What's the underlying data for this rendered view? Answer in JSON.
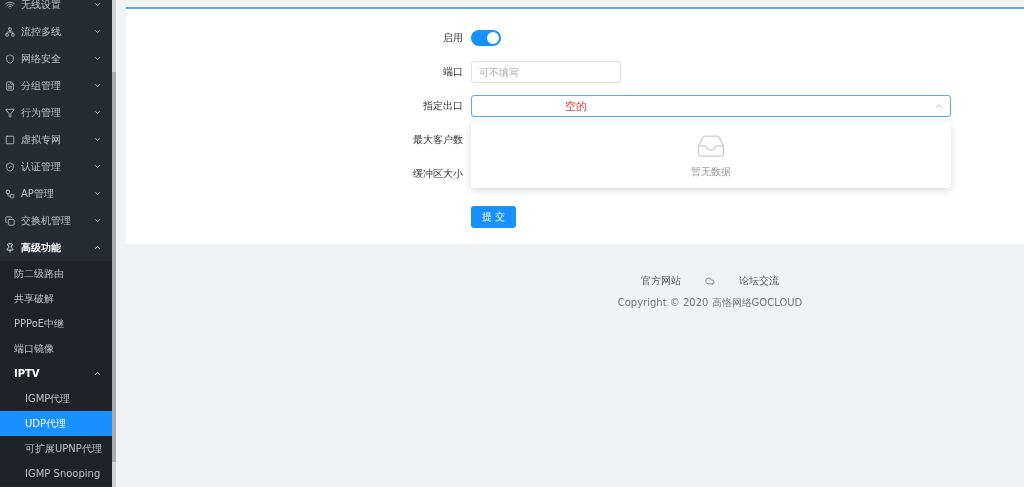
{
  "sidebar": {
    "items": [
      {
        "label": "无线设置",
        "expanded": false,
        "selected": false
      },
      {
        "label": "流控多线",
        "expanded": false,
        "selected": false
      },
      {
        "label": "网络安全",
        "expanded": false,
        "selected": false
      },
      {
        "label": "分组管理",
        "expanded": false,
        "selected": false
      },
      {
        "label": "行为管理",
        "expanded": false,
        "selected": false
      },
      {
        "label": "虚拟专网",
        "expanded": false,
        "selected": false
      },
      {
        "label": "认证管理",
        "expanded": false,
        "selected": false
      },
      {
        "label": "AP管理",
        "expanded": false,
        "selected": false
      },
      {
        "label": "交换机管理",
        "expanded": false,
        "selected": false
      },
      {
        "label": "高级功能",
        "expanded": true,
        "selected": false,
        "children": [
          {
            "label": "防二级路由",
            "selected": false
          },
          {
            "label": "共享破解",
            "selected": false
          },
          {
            "label": "PPPoE中继",
            "selected": false
          },
          {
            "label": "端口镜像",
            "selected": false
          },
          {
            "label": "IPTV",
            "expanded": true,
            "selected": false,
            "children": [
              {
                "label": "IGMP代理",
                "selected": false
              },
              {
                "label": "UDP代理",
                "selected": true
              },
              {
                "label": "可扩展UPNP代理",
                "selected": false
              },
              {
                "label": "IGMP Snooping",
                "selected": false
              }
            ]
          }
        ]
      }
    ]
  },
  "form": {
    "enable": {
      "label": "启用",
      "on": true
    },
    "port": {
      "label": "端口",
      "placeholder": "可不填写"
    },
    "outlet": {
      "label": "指定出口",
      "value": "空的",
      "expanded": true,
      "empty_text": "暂无数据"
    },
    "max_clients": {
      "label": "最大客户数"
    },
    "buffer_size": {
      "label": "缓冲区大小"
    },
    "submit": "提 交"
  },
  "footer": {
    "links": [
      "官方网站",
      "论坛交流"
    ],
    "copyright": "Copyright © 2020 高恪网络GOCLOUD"
  }
}
